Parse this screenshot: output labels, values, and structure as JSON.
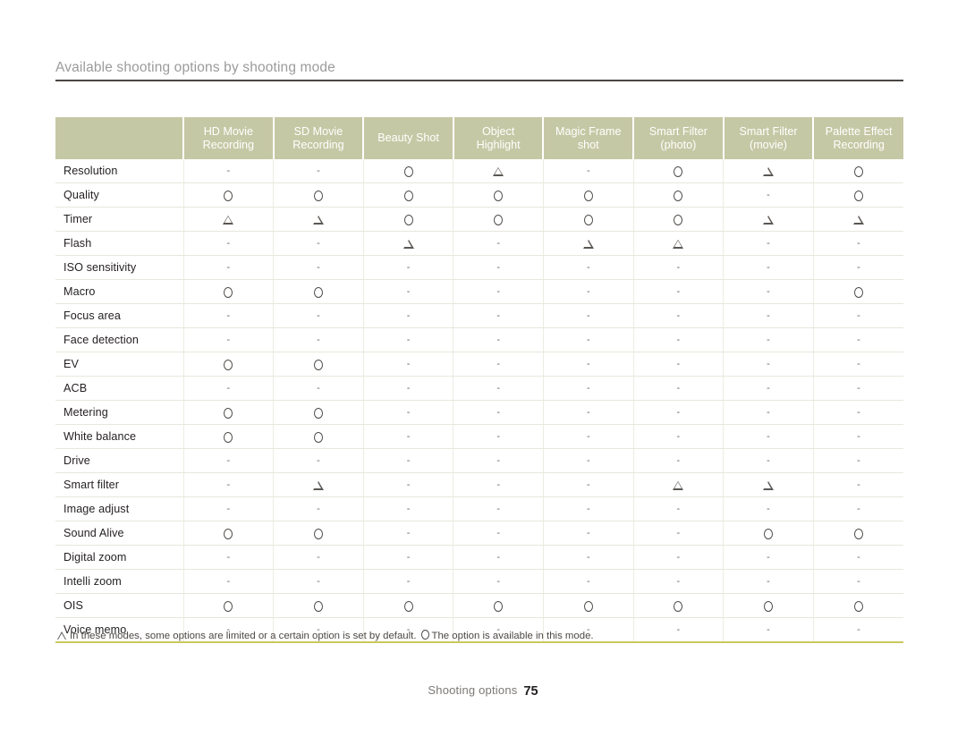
{
  "header": {
    "title": "Available shooting options by shooting mode"
  },
  "table": {
    "corner_label": "",
    "columns": [
      {
        "line1": "HD Movie",
        "line2": "Recording"
      },
      {
        "line1": "SD Movie",
        "line2": "Recording"
      },
      {
        "line1": "Beauty Shot",
        "line2": ""
      },
      {
        "line1": "Object",
        "line2": "Highlight"
      },
      {
        "line1": "Magic Frame",
        "line2": "shot"
      },
      {
        "line1": "Smart Filter",
        "line2": "(photo)"
      },
      {
        "line1": "Smart Filter",
        "line2": "(movie)"
      },
      {
        "line1": "Palette Effect",
        "line2": "Recording"
      }
    ],
    "rows": [
      {
        "label": "Resolution",
        "values": [
          "dash",
          "dash",
          "circle",
          "triangle",
          "dash",
          "circle",
          "triangle",
          "circle"
        ]
      },
      {
        "label": "Quality",
        "values": [
          "circle",
          "circle",
          "circle",
          "circle",
          "circle",
          "circle",
          "dash",
          "circle"
        ]
      },
      {
        "label": "Timer",
        "values": [
          "triangle",
          "triangle",
          "circle",
          "circle",
          "circle",
          "circle",
          "triangle",
          "triangle"
        ]
      },
      {
        "label": "Flash",
        "values": [
          "dash",
          "dash",
          "triangle",
          "dash",
          "triangle",
          "triangle",
          "dash",
          "dash"
        ]
      },
      {
        "label": "ISO sensitivity",
        "values": [
          "dash",
          "dash",
          "dash",
          "dash",
          "dash",
          "dash",
          "dash",
          "dash"
        ]
      },
      {
        "label": "Macro",
        "values": [
          "circle",
          "circle",
          "dash",
          "dash",
          "dash",
          "dash",
          "dash",
          "circle"
        ]
      },
      {
        "label": "Focus area",
        "values": [
          "dash",
          "dash",
          "dash",
          "dash",
          "dash",
          "dash",
          "dash",
          "dash"
        ]
      },
      {
        "label": "Face detection",
        "values": [
          "dash",
          "dash",
          "dash",
          "dash",
          "dash",
          "dash",
          "dash",
          "dash"
        ]
      },
      {
        "label": "EV",
        "values": [
          "circle",
          "circle",
          "dash",
          "dash",
          "dash",
          "dash",
          "dash",
          "dash"
        ]
      },
      {
        "label": "ACB",
        "values": [
          "dash",
          "dash",
          "dash",
          "dash",
          "dash",
          "dash",
          "dash",
          "dash"
        ]
      },
      {
        "label": "Metering",
        "values": [
          "circle",
          "circle",
          "dash",
          "dash",
          "dash",
          "dash",
          "dash",
          "dash"
        ]
      },
      {
        "label": "White balance",
        "values": [
          "circle",
          "circle",
          "dash",
          "dash",
          "dash",
          "dash",
          "dash",
          "dash"
        ]
      },
      {
        "label": "Drive",
        "values": [
          "dash",
          "dash",
          "dash",
          "dash",
          "dash",
          "dash",
          "dash",
          "dash"
        ]
      },
      {
        "label": "Smart filter",
        "values": [
          "dash",
          "triangle",
          "dash",
          "dash",
          "dash",
          "triangle",
          "triangle",
          "dash"
        ]
      },
      {
        "label": "Image adjust",
        "values": [
          "dash",
          "dash",
          "dash",
          "dash",
          "dash",
          "dash",
          "dash",
          "dash"
        ]
      },
      {
        "label": "Sound Alive",
        "values": [
          "circle",
          "circle",
          "dash",
          "dash",
          "dash",
          "dash",
          "circle",
          "circle"
        ]
      },
      {
        "label": "Digital zoom",
        "values": [
          "dash",
          "dash",
          "dash",
          "dash",
          "dash",
          "dash",
          "dash",
          "dash"
        ]
      },
      {
        "label": "Intelli zoom",
        "values": [
          "dash",
          "dash",
          "dash",
          "dash",
          "dash",
          "dash",
          "dash",
          "dash"
        ]
      },
      {
        "label": "OIS",
        "values": [
          "circle",
          "circle",
          "circle",
          "circle",
          "circle",
          "circle",
          "circle",
          "circle"
        ]
      },
      {
        "label": "Voice memo",
        "values": [
          "dash",
          "dash",
          "dash",
          "dash",
          "dash",
          "dash",
          "dash",
          "dash"
        ]
      }
    ]
  },
  "footnote": {
    "part1": "In these modes, some options are limited or a certain option is set by default.",
    "part2": "The option is available in this mode."
  },
  "page_footer": {
    "label": "Shooting options",
    "number": "75"
  },
  "colors": {
    "header_bg": "#c5c8a4",
    "header_text": "#ffffff",
    "title_text": "#9b9b9b",
    "rule": "#4a4644",
    "table_bottom_rule": "#cbc85e",
    "row_divider": "#e8e7dc",
    "body_text": "#231f20"
  },
  "glyphs": {
    "circle": "circle-mark-icon",
    "triangle": "triangle-mark-icon",
    "dash": "dash-mark"
  }
}
